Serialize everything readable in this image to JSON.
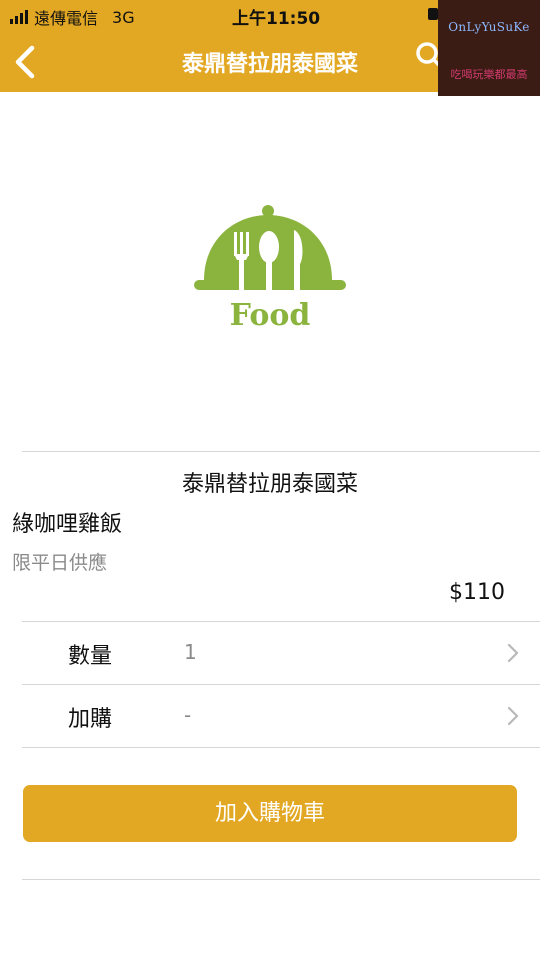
{
  "status_bar": {
    "carrier": "遠傳電信",
    "network": "3G",
    "time": "上午11:50"
  },
  "nav": {
    "title": "泰鼎替拉朋泰國菜",
    "back_icon": "chevron-left-icon",
    "search_icon": "search-icon"
  },
  "watermark": {
    "line1": "OnLyYuSuKe",
    "line2": "吃喝玩樂都最高"
  },
  "logo": {
    "text": "Food",
    "color": "#8bb43f"
  },
  "product": {
    "store_name": "泰鼎替拉朋泰國菜",
    "item_name": "綠咖哩雞飯",
    "note": "限平日供應",
    "price": "$110"
  },
  "options": [
    {
      "label": "數量",
      "value": "1"
    },
    {
      "label": "加購",
      "value": "-"
    }
  ],
  "actions": {
    "add_to_cart": "加入購物車"
  },
  "colors": {
    "accent": "#e3a823",
    "muted_text": "#8a8a8a",
    "divider": "#d6d6d6"
  }
}
